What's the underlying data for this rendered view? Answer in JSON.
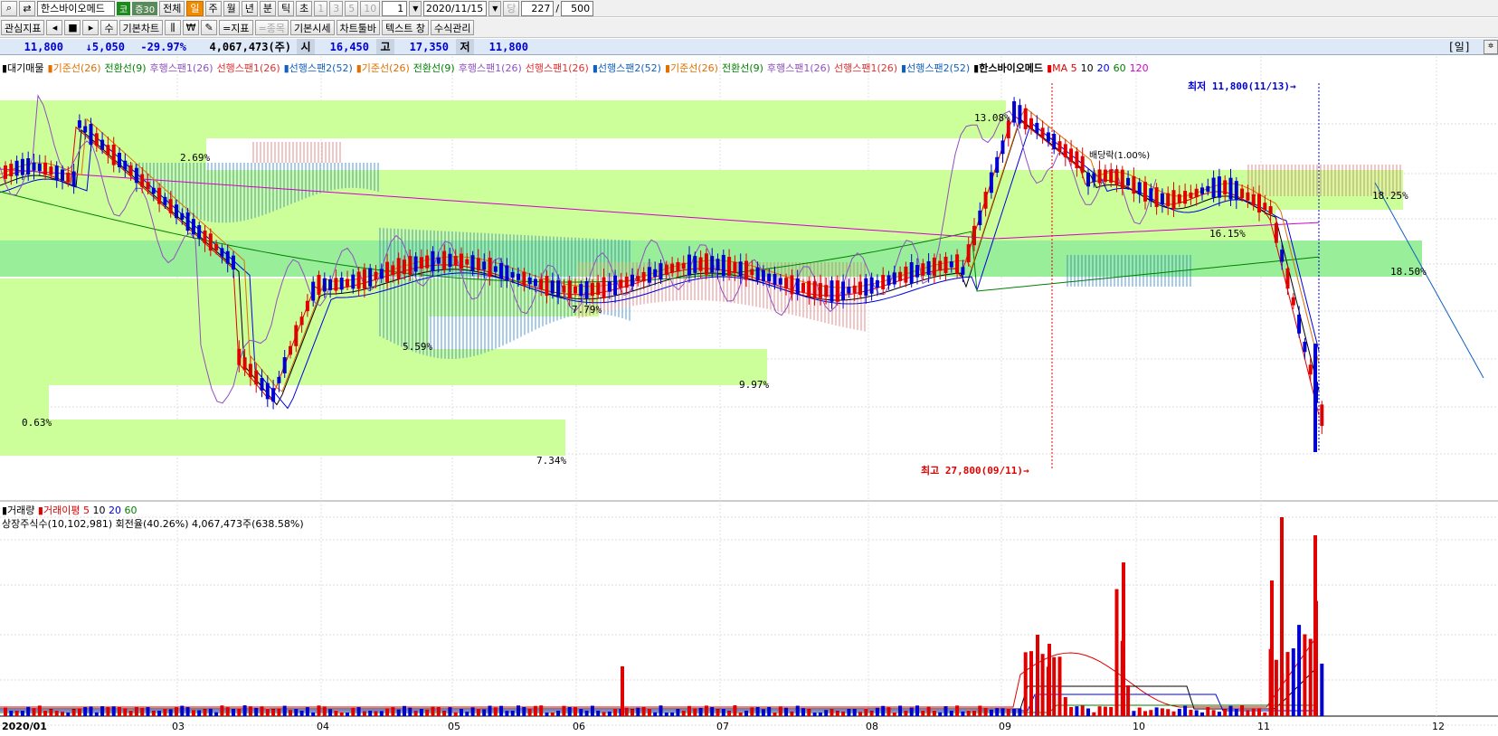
{
  "toolbar": {
    "stock_name": "한스바이오메드",
    "market_badge": "코",
    "margin_badge": "증30",
    "period_all": "전체",
    "periods": [
      "일",
      "주",
      "월",
      "년",
      "분",
      "틱",
      "초"
    ],
    "interval_opts": [
      "1",
      "3",
      "5",
      "10"
    ],
    "interval_value": "1",
    "date_value": "2020/11/15",
    "dang_label": "당",
    "count_value": "227",
    "count_total": "500",
    "slash": "/"
  },
  "toolbar2": {
    "interest": "관심지표",
    "su": "수",
    "basic_chart": "기본차트",
    "won": "₩",
    "indicator": "=지표",
    "stock_item": "=종목",
    "basic_quote": "기본시세",
    "chart_toolbar": "차트툴바",
    "text_window": "텍스트 창",
    "formula_manage": "수식관리"
  },
  "pricebar": {
    "current": "11,800",
    "change": "↓5,050",
    "rate": "-29.97%",
    "volume": "4,067,473(주)",
    "open_label": "시",
    "open": "16,450",
    "high_label": "고",
    "high": "17,350",
    "low_label": "저",
    "low": "11,800",
    "unit_label": "[일]"
  },
  "legend": {
    "items": [
      {
        "text": "▮대기매물",
        "color": "#000000"
      },
      {
        "text": "▮기준선(26)",
        "color": "#e07000"
      },
      {
        "text": "전환선(9)",
        "color": "#008000"
      },
      {
        "text": "후행스팬1(26)",
        "color": "#9050c0"
      },
      {
        "text": "선행스팬1(26)",
        "color": "#e03030"
      },
      {
        "text": "▮선행스팬2(52)",
        "color": "#1060c0"
      },
      {
        "text": "▮기준선(26)",
        "color": "#e07000"
      },
      {
        "text": "전환선(9)",
        "color": "#008000"
      },
      {
        "text": "후행스팬1(26)",
        "color": "#9050c0"
      },
      {
        "text": "선행스팬1(26)",
        "color": "#e03030"
      },
      {
        "text": "▮선행스팬2(52)",
        "color": "#1060c0"
      },
      {
        "text": "▮기준선(26)",
        "color": "#e07000"
      },
      {
        "text": "전환선(9)",
        "color": "#008000"
      },
      {
        "text": "후행스팬1(26)",
        "color": "#9050c0"
      },
      {
        "text": "선행스팬1(26)",
        "color": "#e03030"
      },
      {
        "text": "▮선행스팬2(52)",
        "color": "#1060c0"
      },
      {
        "text": "▮한스바이오메드",
        "color": "#000000"
      },
      {
        "text": "▮MA 5",
        "color": "#e00000"
      },
      {
        "text": "10",
        "color": "#000000"
      },
      {
        "text": "20",
        "color": "#0000e0"
      },
      {
        "text": "60",
        "color": "#008000"
      },
      {
        "text": "120",
        "color": "#d000d0"
      }
    ]
  },
  "annotations": {
    "low_label": "최저 11,800(11/13)→",
    "high_label": "최고 27,800(09/11)→",
    "dividend": "배당락(1.00%)"
  },
  "overhang_pct": [
    "13.08%",
    "2.69%",
    "18.25%",
    "16.15%",
    "18.50%",
    "7.79%",
    "5.59%",
    "9.97%",
    "0.63%",
    "7.34%"
  ],
  "volume_legend": {
    "items": [
      {
        "text": "▮거래량",
        "color": "#000000"
      },
      {
        "text": "▮거래이평 5",
        "color": "#e00000"
      },
      {
        "text": "10",
        "color": "#000000"
      },
      {
        "text": "20",
        "color": "#0000e0"
      },
      {
        "text": "60",
        "color": "#008000"
      }
    ],
    "sub": "상장주식수(10,102,981) 회전율(40.26%) 4,067,473주(638.58%)"
  },
  "x_labels": [
    "2020/01",
    "03",
    "04",
    "05",
    "06",
    "07",
    "08",
    "09",
    "10",
    "11",
    "12"
  ],
  "chart_data": {
    "type": "candlestick",
    "period": "daily",
    "last_date": "2020/11/13",
    "summary": {
      "close": 11800,
      "change": -5050,
      "rate": -29.97,
      "open": 16450,
      "high": 17350,
      "low": 11800,
      "volume": 4067473
    },
    "highest": {
      "value": 27800,
      "date": "09/11"
    },
    "lowest": {
      "value": 11800,
      "date": "11/13"
    },
    "overhang_bands": [
      13.08,
      2.69,
      18.25,
      16.15,
      18.5,
      7.79,
      5.59,
      9.97,
      0.63,
      7.34
    ],
    "ma_periods": [
      5,
      10,
      20,
      60,
      120
    ],
    "volume_ma_periods": [
      5,
      10,
      20,
      60
    ],
    "listed_shares": 10102981,
    "turnover_pct": 40.26
  },
  "colors": {
    "up": "#e00000",
    "down": "#0000d0",
    "band": "#ccff99",
    "band_dark": "#99ee88"
  }
}
